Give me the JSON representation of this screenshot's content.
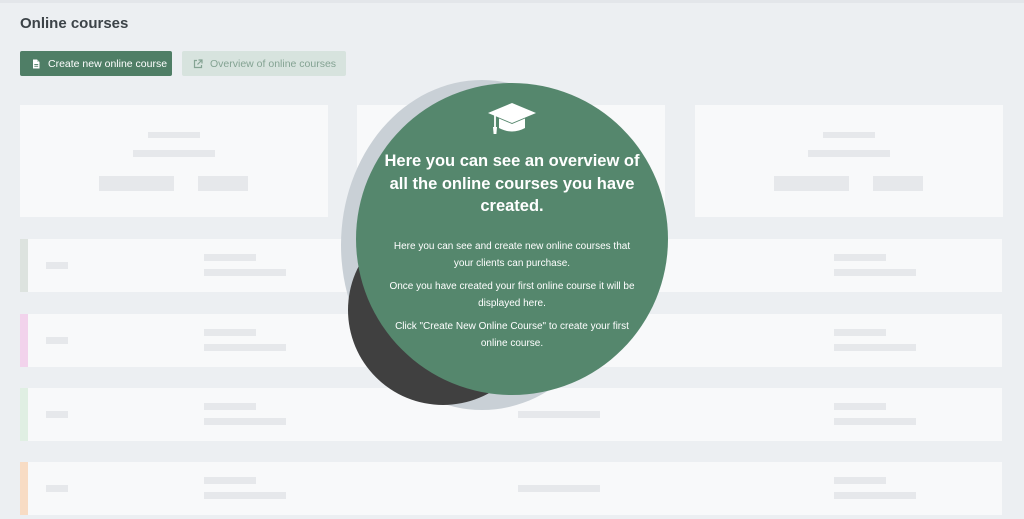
{
  "page": {
    "title": "Online courses"
  },
  "toolbar": {
    "create_label": "Create new online course",
    "create_icon": "file-icon",
    "overview_label": "Overview of online courses",
    "overview_icon": "external-link-icon"
  },
  "row_accents": [
    "#dde3df",
    "#f2d3ec",
    "#e0efe3",
    "#f8dcc4"
  ],
  "overlay": {
    "icon": "graduation-cap-icon",
    "heading": "Here you can see an overview of all the online courses you have created.",
    "paragraphs": [
      "Here you can see and create new online courses that your clients can purchase.",
      "Once you have created your first online course it will be displayed here.",
      "Click \"Create New Online Course\" to create your first online course."
    ]
  },
  "colors": {
    "brand_green": "#4f7e66",
    "overlay_green": "#55876d",
    "background": "#eceff2",
    "skeleton": "#e6e8eb"
  }
}
